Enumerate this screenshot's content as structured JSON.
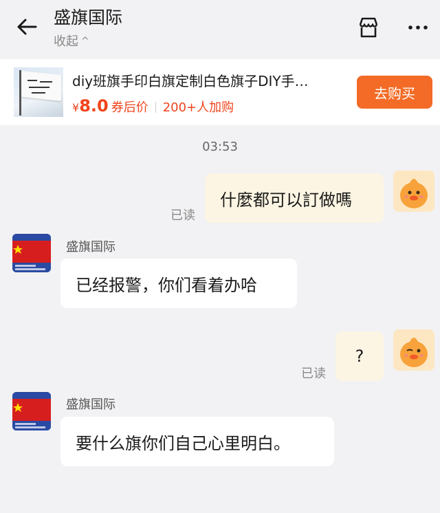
{
  "header": {
    "title": "盛旗国际",
    "subtitle": "收起",
    "icons": [
      "back-arrow-icon",
      "store-icon",
      "more-icon"
    ]
  },
  "product": {
    "name": "diy班旗手印白旗定制白色旗子DIY手…",
    "price_symbol": "¥",
    "price": "8.0",
    "price_note": "券后价",
    "buyers": "200+人加购",
    "buy_button": "去购买"
  },
  "chat": {
    "timestamp": "03:53",
    "messages": [
      {
        "side": "out",
        "text": "什麼都可以訂做嗎",
        "status": "已读"
      },
      {
        "side": "in",
        "sender": "盛旗国际",
        "text": "已经报警，你们看着办哈"
      },
      {
        "side": "out",
        "text": "?",
        "status": "已读"
      },
      {
        "side": "in",
        "sender": "盛旗国际",
        "text": "要什么旗你们自己心里明白。"
      }
    ]
  },
  "colors": {
    "accent": "#f0451c",
    "buy_button": "#f36b26",
    "outgoing_bubble": "#fdf5e3",
    "incoming_bubble": "#ffffff",
    "background": "#f2f2f4"
  }
}
